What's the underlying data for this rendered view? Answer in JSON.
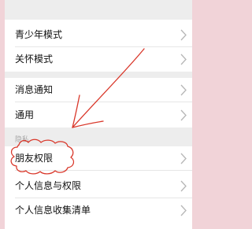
{
  "settings": {
    "rows": [
      {
        "label": "青少年模式"
      },
      {
        "label": "关怀模式"
      },
      {
        "label": "消息通知"
      },
      {
        "label": "通用"
      },
      {
        "label": "朋友权限"
      },
      {
        "label": "个人信息与权限"
      },
      {
        "label": "个人信息收集清单"
      }
    ],
    "privacy_section_title": "隐私"
  },
  "annotation": {
    "color": "#d9372a"
  }
}
